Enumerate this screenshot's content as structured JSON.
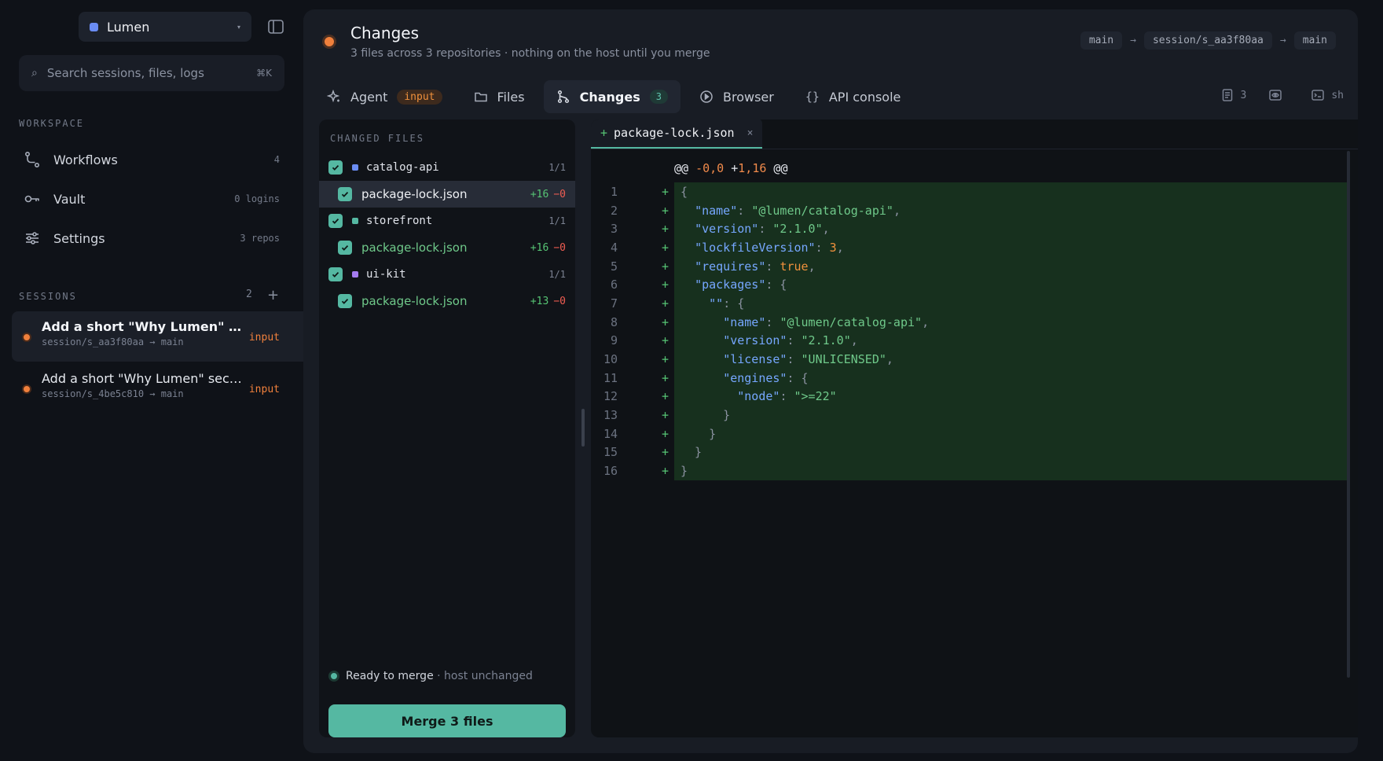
{
  "workspace": {
    "name": "Lumen"
  },
  "search": {
    "placeholder": "Search sessions, files, logs",
    "shortcut": "⌘K"
  },
  "sidebar": {
    "workspace_label": "WORKSPACE",
    "items": [
      {
        "label": "Workflows",
        "meta": "4",
        "icon": "workflow-icon"
      },
      {
        "label": "Vault",
        "meta": "0 logins",
        "icon": "key-icon"
      },
      {
        "label": "Settings",
        "meta": "3 repos",
        "icon": "sliders-icon"
      }
    ],
    "sessions_label": "SESSIONS",
    "sessions_count": "2",
    "sessions_add": "+",
    "sessions": [
      {
        "title": "Add a short \"Why Lumen\" section to the README",
        "branch": "session/s_aa3f80aa → main",
        "badge": "input",
        "active": true
      },
      {
        "title": "Add a short \"Why Lumen\" section to the README",
        "branch": "session/s_4be5c810 → main",
        "badge": "input",
        "active": false
      }
    ]
  },
  "header": {
    "title": "Changes",
    "subtitle": "3 files across 3 repositories · nothing on the host until you merge",
    "branches": [
      "main",
      "session/s_aa3f80aa",
      "main"
    ],
    "arrow": "→"
  },
  "tabs": [
    {
      "label": "Agent",
      "badge": "input",
      "icon": "sparkle-icon"
    },
    {
      "label": "Files",
      "icon": "folder-icon"
    },
    {
      "label": "Changes",
      "badge": "3",
      "icon": "git-branch-icon",
      "active": true
    },
    {
      "label": "Browser",
      "icon": "play-circle-icon"
    },
    {
      "label": "API console",
      "icon": "braces-icon"
    }
  ],
  "tools": [
    {
      "icon": "document-icon",
      "label": "3"
    },
    {
      "icon": "eye-icon",
      "label": ""
    },
    {
      "icon": "terminal-icon",
      "label": "sh"
    }
  ],
  "changed_files": {
    "title": "CHANGED FILES",
    "repos": [
      {
        "name": "catalog-api",
        "count": "1/1",
        "color": "#6a8cf3",
        "files": [
          {
            "name": "package-lock.json",
            "add": "+16",
            "del": "−0",
            "selected": true
          }
        ]
      },
      {
        "name": "storefront",
        "count": "1/1",
        "color": "#55b8a2",
        "files": [
          {
            "name": "package-lock.json",
            "add": "+16",
            "del": "−0",
            "selected": false
          }
        ]
      },
      {
        "name": "ui-kit",
        "count": "1/1",
        "color": "#a57cf0",
        "files": [
          {
            "name": "package-lock.json",
            "add": "+13",
            "del": "−0",
            "selected": false
          }
        ]
      }
    ],
    "ready_label": "Ready to merge",
    "ready_sub": " · host unchanged",
    "merge_button": "Merge 3 files"
  },
  "diff": {
    "tab_prefix": "+",
    "tab_name": "package-lock.json",
    "tab_close": "×",
    "hunk": {
      "a": "@@ ",
      "old": "-0,0",
      "mid": " +",
      "new": "1,16",
      "b": " @@"
    },
    "marker": "+",
    "lines": [
      [
        [
          "p",
          "{"
        ]
      ],
      [
        [
          "p",
          "  "
        ],
        [
          "k",
          "\"name\""
        ],
        [
          "p",
          ": "
        ],
        [
          "s",
          "\"@lumen/catalog-api\""
        ],
        [
          "p",
          ","
        ]
      ],
      [
        [
          "p",
          "  "
        ],
        [
          "k",
          "\"version\""
        ],
        [
          "p",
          ": "
        ],
        [
          "s",
          "\"2.1.0\""
        ],
        [
          "p",
          ","
        ]
      ],
      [
        [
          "p",
          "  "
        ],
        [
          "k",
          "\"lockfileVersion\""
        ],
        [
          "p",
          ": "
        ],
        [
          "n",
          "3"
        ],
        [
          "p",
          ","
        ]
      ],
      [
        [
          "p",
          "  "
        ],
        [
          "k",
          "\"requires\""
        ],
        [
          "p",
          ": "
        ],
        [
          "n",
          "true"
        ],
        [
          "p",
          ","
        ]
      ],
      [
        [
          "p",
          "  "
        ],
        [
          "k",
          "\"packages\""
        ],
        [
          "p",
          ": {"
        ]
      ],
      [
        [
          "p",
          "    "
        ],
        [
          "k",
          "\"\""
        ],
        [
          "p",
          ": {"
        ]
      ],
      [
        [
          "p",
          "      "
        ],
        [
          "k",
          "\"name\""
        ],
        [
          "p",
          ": "
        ],
        [
          "s",
          "\"@lumen/catalog-api\""
        ],
        [
          "p",
          ","
        ]
      ],
      [
        [
          "p",
          "      "
        ],
        [
          "k",
          "\"version\""
        ],
        [
          "p",
          ": "
        ],
        [
          "s",
          "\"2.1.0\""
        ],
        [
          "p",
          ","
        ]
      ],
      [
        [
          "p",
          "      "
        ],
        [
          "k",
          "\"license\""
        ],
        [
          "p",
          ": "
        ],
        [
          "s",
          "\"UNLICENSED\""
        ],
        [
          "p",
          ","
        ]
      ],
      [
        [
          "p",
          "      "
        ],
        [
          "k",
          "\"engines\""
        ],
        [
          "p",
          ": {"
        ]
      ],
      [
        [
          "p",
          "        "
        ],
        [
          "k",
          "\"node\""
        ],
        [
          "p",
          ": "
        ],
        [
          "s",
          "\">=22\""
        ]
      ],
      [
        [
          "p",
          "      }"
        ]
      ],
      [
        [
          "p",
          "    }"
        ]
      ],
      [
        [
          "p",
          "  }"
        ]
      ],
      [
        [
          "p",
          "}"
        ]
      ]
    ]
  },
  "colors": {
    "accent": "#55b8a2",
    "warning": "#f0803c",
    "added": "#56c474",
    "removed": "#f05d52"
  }
}
